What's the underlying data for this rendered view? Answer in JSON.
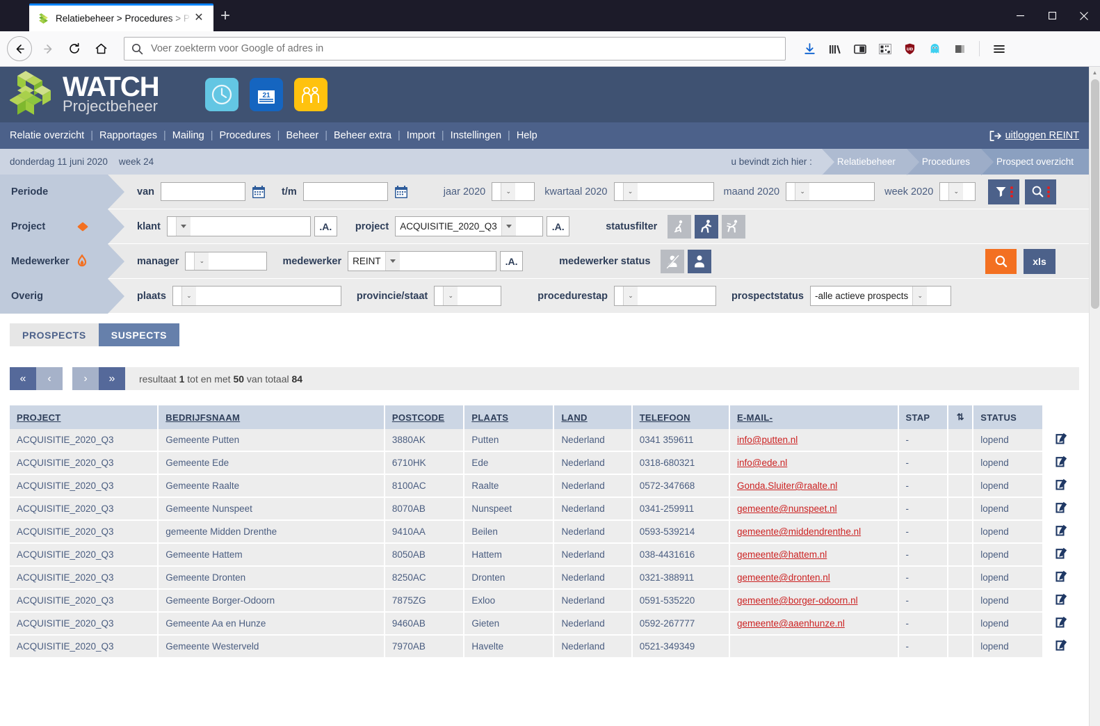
{
  "browser": {
    "tab_title": "Relatiebeheer > Procedures > P",
    "tab_close": "✕",
    "new_tab": "+",
    "url_placeholder": "Voer zoekterm voor Google of adres in",
    "url_value": "",
    "nav": {
      "back": "back-arrow-icon",
      "forward": "forward-arrow-icon",
      "reload": "reload-icon",
      "home": "home-icon"
    },
    "toolbar_icons": [
      "downloads-icon",
      "library-icon",
      "sidebar-icon",
      "qr-pocket-icon",
      "ublock-shield-icon",
      "ghostery-icon",
      "screenshot-icon",
      "hamburger-menu-icon"
    ],
    "window_buttons": [
      "minimize-button",
      "maximize-button",
      "close-button"
    ]
  },
  "app": {
    "logo_title": "WATCH",
    "logo_subtitle": "Projectbeheer",
    "header_icons": [
      "clock-icon",
      "calendar-21-icon",
      "people-group-icon"
    ],
    "menu": [
      "Relatie overzicht",
      "Rapportages",
      "Mailing",
      "Procedures",
      "Beheer",
      "Beheer extra",
      "Import",
      "Instellingen",
      "Help"
    ],
    "menu_separator": "|",
    "logout_label": "uitloggen REINT"
  },
  "crumbbar": {
    "date": "donderdag 11 juni 2020",
    "week": "week 24",
    "here_label": "u bevindt zich hier :",
    "crumbs": [
      "Relatiebeheer",
      "Procedures",
      "Prospect overzicht"
    ]
  },
  "filters": {
    "periode": {
      "caption": "Periode",
      "van_label": "van",
      "van_value": "",
      "tm_label": "t/m",
      "tm_value": "",
      "jaar_label": "jaar 2020",
      "jaar_value": "",
      "kwartaal_label": "kwartaal 2020",
      "kwartaal_value": "",
      "maand_label": "maand 2020",
      "maand_value": "",
      "week_label": "week 2020",
      "week_value": "",
      "filter_button": "filter-funnel-button",
      "search_button": "search-magnifier-button"
    },
    "project": {
      "caption": "Project",
      "caption_icon": "orange-diamond-icon",
      "klant_label": "klant",
      "klant_value": "",
      "klant_az": ".A.",
      "project_label": "project",
      "project_value": "ACQUISITIE_2020_Q3",
      "project_az": ".A.",
      "statusfilter_label": "statusfilter",
      "status_icons": [
        "walking-slow-icon",
        "running-icon",
        "sprinting-icon"
      ],
      "status_active_index": 1
    },
    "medewerker": {
      "caption": "Medewerker",
      "caption_icon": "orange-flame-icon",
      "manager_label": "manager",
      "manager_value": "",
      "medewerker_label": "medewerker",
      "medewerker_value": "REINT",
      "medewerker_az": ".A.",
      "status_label": "medewerker status",
      "status_icons": [
        "person-inactive-icon",
        "person-active-icon"
      ],
      "status_active_index": 1,
      "search_button": "search-magnifier-button",
      "xls_label": "xls"
    },
    "overig": {
      "caption": "Overig",
      "plaats_label": "plaats",
      "plaats_value": "",
      "provincie_label": "provincie/staat",
      "provincie_value": "",
      "procedurestap_label": "procedurestap",
      "procedurestap_value": "",
      "prospectstatus_label": "prospectstatus",
      "prospectstatus_value": "-alle actieve prospects"
    }
  },
  "tabs": [
    {
      "label": "PROSPECTS",
      "active": false
    },
    {
      "label": "SUSPECTS",
      "active": true
    }
  ],
  "pagination": {
    "first": "«",
    "prev": "‹",
    "next": "›",
    "last": "»",
    "result_prefix": "resultaat",
    "from": "1",
    "mid": "tot en met",
    "to": "50",
    "suffix": "van totaal",
    "total": "84"
  },
  "table": {
    "columns": [
      {
        "label": "PROJECT",
        "sortable": true
      },
      {
        "label": "BEDRIJFSNAAM",
        "sortable": true
      },
      {
        "label": "POSTCODE",
        "sortable": true
      },
      {
        "label": "PLAATS",
        "sortable": true
      },
      {
        "label": "LAND",
        "sortable": true
      },
      {
        "label": "TELEFOON",
        "sortable": true
      },
      {
        "label": "E-MAIL-",
        "sortable": true
      },
      {
        "label": "STAP",
        "sortable": false
      },
      {
        "label": "⇅",
        "sortable": false
      },
      {
        "label": "STATUS",
        "sortable": false
      },
      {
        "label": "",
        "sortable": false
      }
    ],
    "rows": [
      {
        "project": "ACQUISITIE_2020_Q3",
        "bedrijfsnaam": "Gemeente Putten",
        "postcode": "3880AK",
        "plaats": "Putten",
        "land": "Nederland",
        "telefoon": "0341 359611",
        "email": "info@putten.nl",
        "stap": "-",
        "sort": "",
        "status": "lopend",
        "action": "edit-icon"
      },
      {
        "project": "ACQUISITIE_2020_Q3",
        "bedrijfsnaam": "Gemeente Ede",
        "postcode": "6710HK",
        "plaats": "Ede",
        "land": "Nederland",
        "telefoon": "0318-680321",
        "email": "info@ede.nl",
        "stap": "-",
        "sort": "",
        "status": "lopend",
        "action": "edit-icon"
      },
      {
        "project": "ACQUISITIE_2020_Q3",
        "bedrijfsnaam": "Gemeente Raalte",
        "postcode": "8100AC",
        "plaats": "Raalte",
        "land": "Nederland",
        "telefoon": "0572-347668",
        "email": "Gonda.Sluiter@raalte.nl",
        "stap": "-",
        "sort": "",
        "status": "lopend",
        "action": "edit-icon"
      },
      {
        "project": "ACQUISITIE_2020_Q3",
        "bedrijfsnaam": "Gemeente Nunspeet",
        "postcode": "8070AB",
        "plaats": "Nunspeet",
        "land": "Nederland",
        "telefoon": "0341-259911",
        "email": "gemeente@nunspeet.nl",
        "stap": "-",
        "sort": "",
        "status": "lopend",
        "action": "edit-icon"
      },
      {
        "project": "ACQUISITIE_2020_Q3",
        "bedrijfsnaam": "gemeente Midden Drenthe",
        "postcode": "9410AA",
        "plaats": "Beilen",
        "land": "Nederland",
        "telefoon": "0593-539214",
        "email": "gemeente@middendrenthe.nl",
        "stap": "-",
        "sort": "",
        "status": "lopend",
        "action": "edit-icon"
      },
      {
        "project": "ACQUISITIE_2020_Q3",
        "bedrijfsnaam": "Gemeente Hattem",
        "postcode": "8050AB",
        "plaats": "Hattem",
        "land": "Nederland",
        "telefoon": "038-4431616",
        "email": "gemeente@hattem.nl",
        "stap": "-",
        "sort": "",
        "status": "lopend",
        "action": "edit-icon"
      },
      {
        "project": "ACQUISITIE_2020_Q3",
        "bedrijfsnaam": "Gemeente Dronten",
        "postcode": "8250AC",
        "plaats": "Dronten",
        "land": "Nederland",
        "telefoon": "0321-388911",
        "email": "gemeente@dronten.nl",
        "stap": "-",
        "sort": "",
        "status": "lopend",
        "action": "edit-icon"
      },
      {
        "project": "ACQUISITIE_2020_Q3",
        "bedrijfsnaam": "Gemeente Borger-Odoorn",
        "postcode": "7875ZG",
        "plaats": "Exloo",
        "land": "Nederland",
        "telefoon": "0591-535220",
        "email": "gemeente@borger-odoorn.nl",
        "stap": "-",
        "sort": "",
        "status": "lopend",
        "action": "edit-icon"
      },
      {
        "project": "ACQUISITIE_2020_Q3",
        "bedrijfsnaam": "Gemeente Aa en Hunze",
        "postcode": "9460AB",
        "plaats": "Gieten",
        "land": "Nederland",
        "telefoon": "0592-267777",
        "email": "gemeente@aaenhunze.nl",
        "stap": "-",
        "sort": "",
        "status": "lopend",
        "action": "edit-icon"
      },
      {
        "project": "ACQUISITIE_2020_Q3",
        "bedrijfsnaam": "Gemeente Westerveld",
        "postcode": "7970AB",
        "plaats": "Havelte",
        "land": "Nederland",
        "telefoon": "0521-349349",
        "email": "",
        "stap": "-",
        "sort": "",
        "status": "lopend",
        "action": "edit-icon"
      }
    ]
  },
  "colors": {
    "header_blue": "#3f5272",
    "menu_blue": "#4c618a",
    "crumb_blue": "#ccd4e2",
    "accent_orange": "#f37021",
    "link_red": "#cc2222"
  }
}
